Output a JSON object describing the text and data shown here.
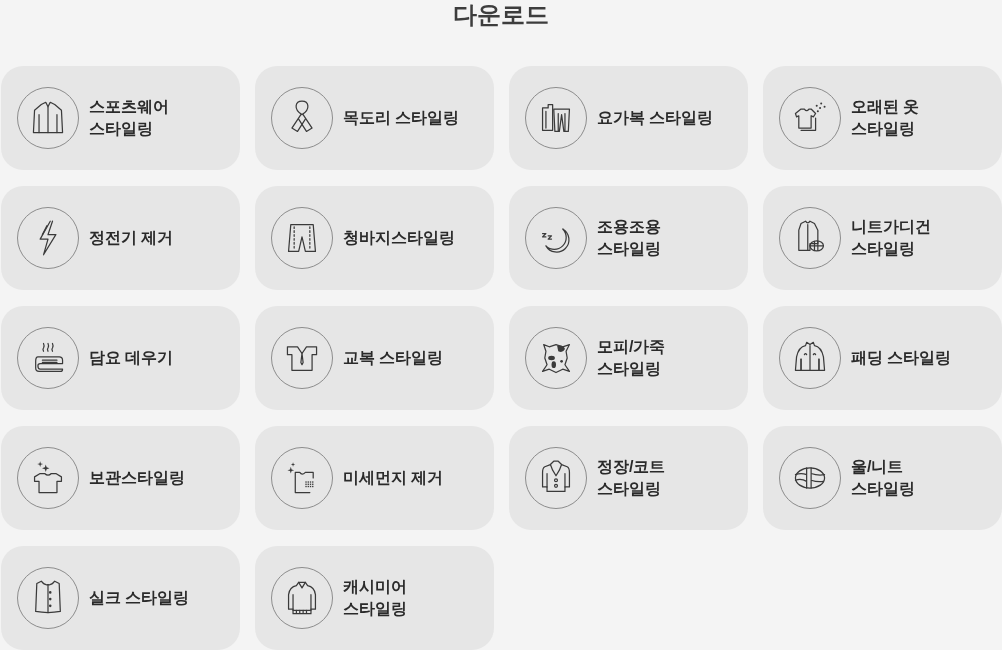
{
  "title": "다운로드",
  "cards": [
    {
      "label": "스포츠웨어\n스타일링"
    },
    {
      "label": "목도리 스타일링"
    },
    {
      "label": "요가복 스타일링"
    },
    {
      "label": "오래된 옷\n스타일링"
    },
    {
      "label": "정전기 제거"
    },
    {
      "label": "청바지스타일링"
    },
    {
      "label": "조용조용\n스타일링"
    },
    {
      "label": "니트가디건\n스타일링"
    },
    {
      "label": "담요 데우기"
    },
    {
      "label": "교복 스타일링"
    },
    {
      "label": "모피/가죽\n스타일링"
    },
    {
      "label": "패딩 스타일링"
    },
    {
      "label": "보관스타일링"
    },
    {
      "label": "미세먼지 제거"
    },
    {
      "label": "정장/코트\n스타일링"
    },
    {
      "label": "울/니트\n스타일링"
    },
    {
      "label": "실크 스타일링"
    },
    {
      "label": "캐시미어\n스타일링"
    }
  ]
}
